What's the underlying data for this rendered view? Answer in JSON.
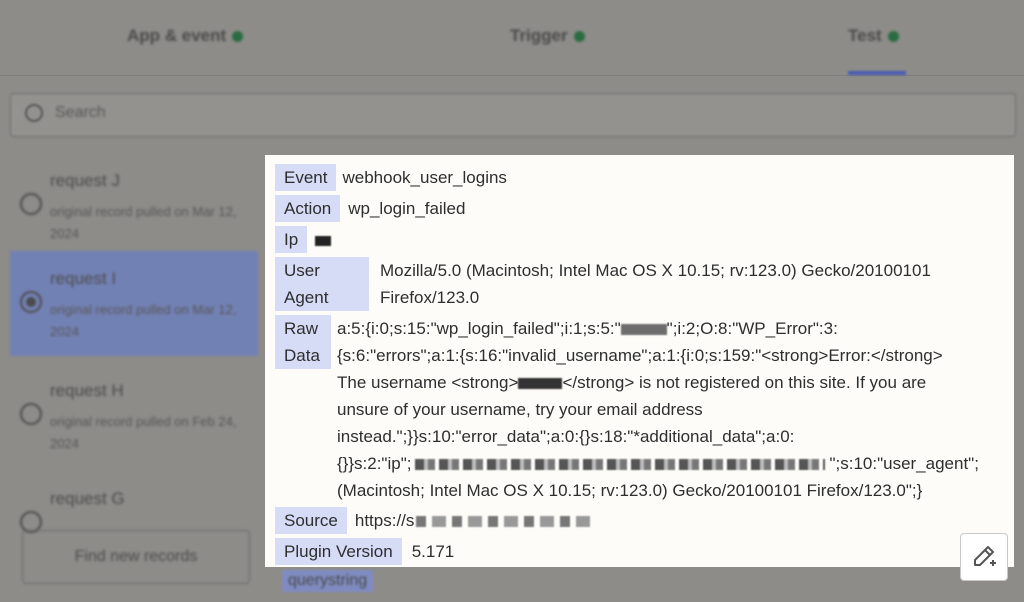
{
  "tabs": [
    {
      "label": "App & event"
    },
    {
      "label": "Trigger"
    },
    {
      "label": "Test"
    }
  ],
  "search": {
    "placeholder": "Search"
  },
  "requests": [
    {
      "title": "request J",
      "subtitle": "original record pulled on Mar 12, 2024",
      "selected": false
    },
    {
      "title": "request I",
      "subtitle": "original record pulled on Mar 12, 2024",
      "selected": true
    },
    {
      "title": "request H",
      "subtitle": "original record pulled on Feb 24, 2024",
      "selected": false
    },
    {
      "title": "request G",
      "subtitle": "",
      "selected": false
    }
  ],
  "find_button": "Find new records",
  "behind_tag": "querystring",
  "fields": {
    "event": {
      "label": "Event",
      "value": "webhook_user_logins"
    },
    "action": {
      "label": "Action",
      "value": "wp_login_failed"
    },
    "ip": {
      "label": "Ip"
    },
    "user_agent": {
      "label_1": "User",
      "label_2": "Agent",
      "line1": "Mozilla/5.0 (Macintosh; Intel Mac OS X 10.15; rv:123.0) Gecko/20100101",
      "line2": "Firefox/123.0"
    },
    "raw_data": {
      "label_1": "Raw",
      "label_2": "Data",
      "line1a": "a:5:{i:0;s:15:\"wp_login_failed\";i:1;s:5:\"",
      "line1b": "\";i:2;O:8:\"WP_Error\":3:",
      "line2": "{s:6:\"errors\";a:1:{s:16:\"invalid_username\";a:1:{i:0;s:159:\"<strong>Error:</strong>",
      "line3a": "The username <strong>",
      "line3b": "</strong> is not registered on this site. If you are",
      "line4": "unsure of your username, try your email address",
      "line5": "instead.\";}}s:10:\"error_data\";a:0:{}s:18:\"*additional_data\";a:0:",
      "line6a": "{}}s:2:\"ip\";",
      "line6b": "\";s:10:\"user_agent\";",
      "line7": "(Macintosh; Intel Mac OS X 10.15; rv:123.0) Gecko/20100101 Firefox/123.0\";}"
    },
    "source": {
      "label": "Source",
      "value": "https://s"
    },
    "plugin_version": {
      "label": "Plugin Version",
      "value": "5.171"
    }
  },
  "icons": {
    "edit": "pencil-edit-icon",
    "search": "search-icon"
  },
  "colors": {
    "label_bg": "#d6dbf6",
    "panel_bg": "#fdfcf9",
    "status_dot": "#2a6b3f",
    "selected_row": "#7281b4"
  }
}
